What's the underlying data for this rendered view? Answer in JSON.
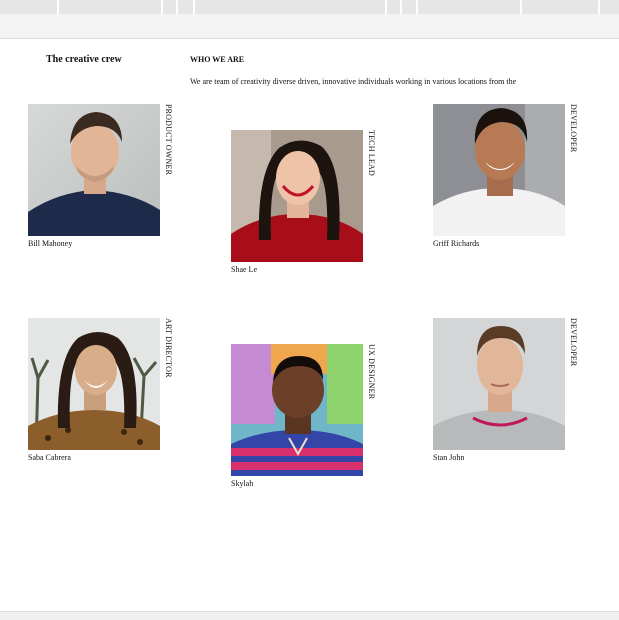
{
  "section_title": "The creative crew",
  "about": {
    "heading": "WHO WE ARE",
    "text": "We are team of creativity diverse driven, innovative individuals working in various locations from the"
  },
  "members": [
    {
      "name": "Bill Mahoney",
      "role": "PRODUCT OWNER",
      "photo_icon": "portrait-man-navy-polo"
    },
    {
      "name": "Shae Le",
      "role": "TECH LEAD",
      "photo_icon": "portrait-woman-red-sweater"
    },
    {
      "name": "Griff Richards",
      "role": "DEVELOPER",
      "photo_icon": "portrait-man-white-tshirt"
    },
    {
      "name": "Saba Cabrera",
      "role": "ART DIRECTOR",
      "photo_icon": "portrait-woman-palm-trees"
    },
    {
      "name": "Skylah",
      "role": "UX DESIGNER",
      "photo_icon": "portrait-man-colorful-wall"
    },
    {
      "name": "Stan John",
      "role": "DEVELOPER",
      "photo_icon": "portrait-man-grey-sweater"
    }
  ],
  "colors": {
    "background": "#ffffff",
    "chrome": "#e6e6e6",
    "text": "#111111"
  }
}
